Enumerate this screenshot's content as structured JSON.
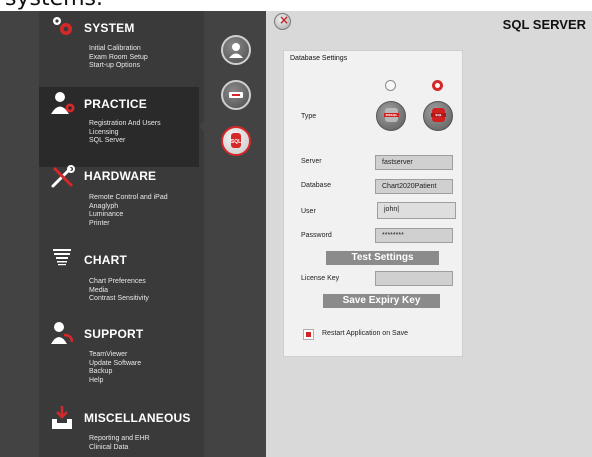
{
  "cropped_header_text": "systems.",
  "page_title": "SQL SERVER",
  "close_symbol": "×",
  "sidebar": {
    "sections": [
      {
        "title": "SYSTEM",
        "icon": "gears-icon",
        "items": [
          "Initial Calibration",
          "Exam Room Setup",
          "Start-up Options"
        ]
      },
      {
        "title": "PRACTICE",
        "icon": "user-gear-icon",
        "items": [
          "Registration And Users",
          "Licensing",
          "SQL Server"
        ],
        "active": true
      },
      {
        "title": "HARDWARE",
        "icon": "tools-icon",
        "items": [
          "Remote Control and iPad",
          "Anaglyph",
          "Luminance",
          "Printer"
        ]
      },
      {
        "title": "CHART",
        "icon": "eye-chart-icon",
        "items": [
          "Chart Preferences",
          "Media",
          "Contrast Sensitivity"
        ]
      },
      {
        "title": "SUPPORT",
        "icon": "support-user-icon",
        "items": [
          "TeamViewer",
          "Update Software",
          "Backup",
          "Help"
        ]
      },
      {
        "title": "MISCELLANEOUS",
        "icon": "download-tray-icon",
        "items": [
          "Reporting and EHR",
          "Clinical Data"
        ]
      }
    ],
    "quick_buttons": [
      "user-icon",
      "license-key-icon",
      "sql-icon"
    ],
    "active_quick_button": "sql-icon"
  },
  "panel": {
    "header": "Database Settings",
    "type_label": "Type",
    "type_options": [
      {
        "icon": "mssql-database-icon",
        "selected": false
      },
      {
        "icon": "sql-database-icon",
        "selected": true
      }
    ],
    "server_label": "Server",
    "server_value": "fastserver",
    "database_label": "Database",
    "database_value": "Chart2020Patient",
    "user_label": "User",
    "user_value": "john|",
    "password_label": "Password",
    "password_value": "********",
    "test_button": "Test Settings",
    "license_label": "License Key",
    "license_value": "",
    "save_expiry_button": "Save Expiry Key",
    "restart_label": "Restart Application on Save",
    "restart_checked": true
  },
  "colors": {
    "sidebar_bg": "#434343",
    "active_band": "#2a2a2a",
    "accent_red": "#d62828",
    "content_bg": "#d9d9d9",
    "panel_bg": "#f1f1f1"
  }
}
